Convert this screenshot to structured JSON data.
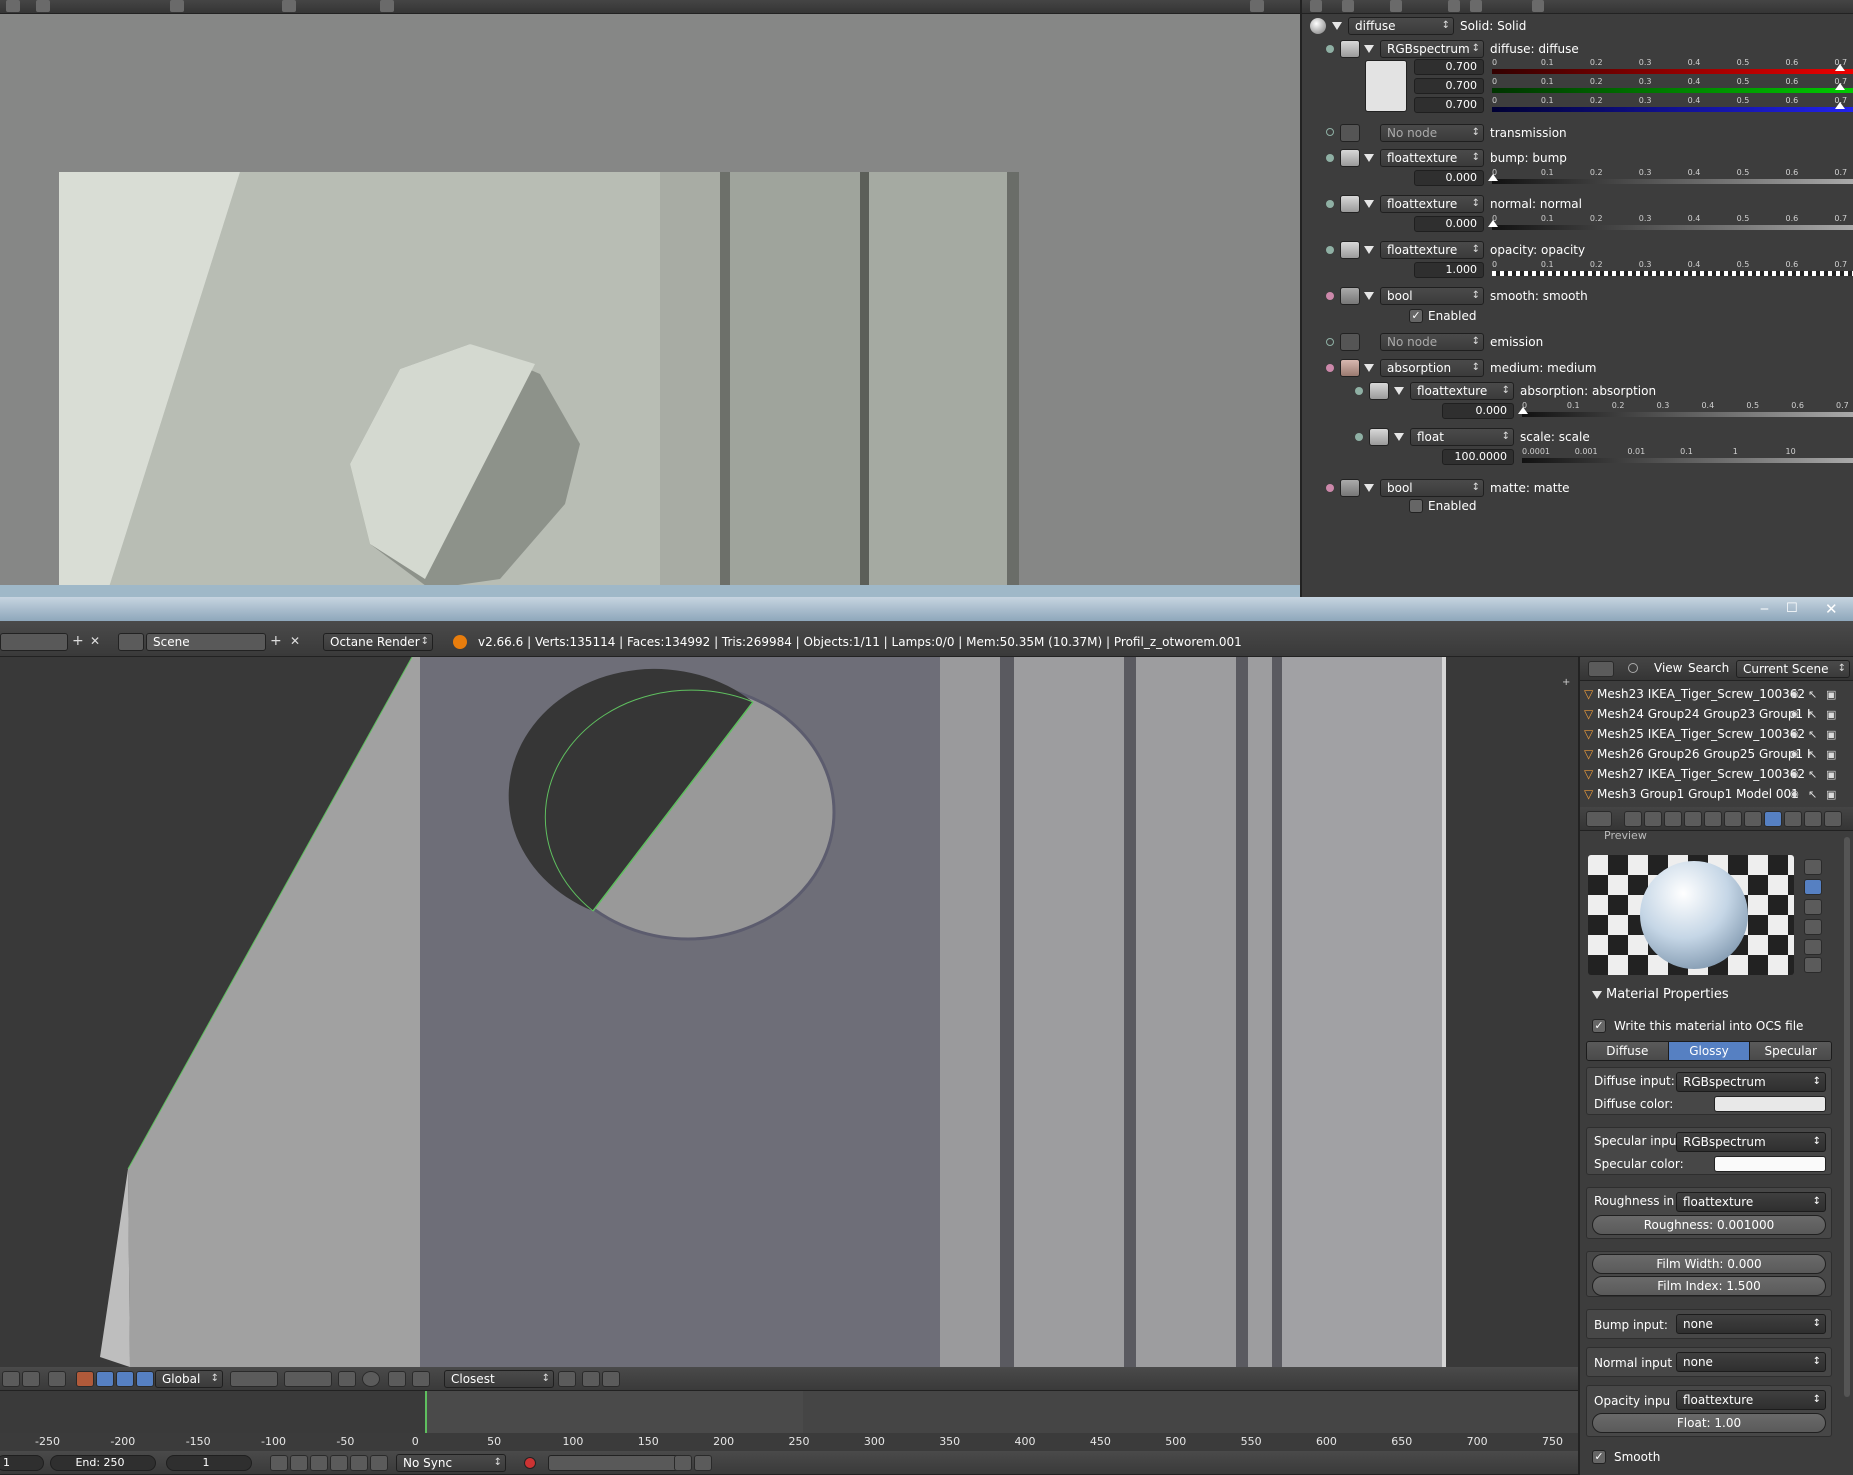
{
  "top_node_panel": {
    "material": {
      "name": "diffuse",
      "mode_label": "Solid: Solid"
    },
    "inputs": [
      {
        "type": "RGBspectrum",
        "label": "diffuse: diffuse",
        "values": [
          "0.700",
          "0.700",
          "0.700"
        ]
      },
      {
        "type": "No node",
        "label": "transmission"
      },
      {
        "type": "floattexture",
        "label": "bump: bump",
        "value": "0.000"
      },
      {
        "type": "floattexture",
        "label": "normal: normal",
        "value": "0.000"
      },
      {
        "type": "floattexture",
        "label": "opacity: opacity",
        "value": "1.000"
      },
      {
        "type": "bool",
        "label": "smooth: smooth",
        "checkbox_label": "Enabled",
        "checked": true
      },
      {
        "type": "No node",
        "label": "emission"
      },
      {
        "type": "absorption",
        "label": "medium: medium"
      },
      {
        "type": "floattexture",
        "label": "absorption: absorption",
        "value": "0.000"
      },
      {
        "type": "float",
        "label": "scale: scale",
        "value": "100.0000"
      },
      {
        "type": "bool",
        "label": "matte: matte",
        "checkbox_label": "Enabled",
        "checked": false
      }
    ],
    "slider_ticks": [
      "0",
      "0.1",
      "0.2",
      "0.3",
      "0.4",
      "0.5",
      "0.6",
      "0.7"
    ],
    "log_ticks": [
      "0.0001",
      "0.001",
      "0.01",
      "0.1",
      "1",
      "10"
    ]
  },
  "info_header": {
    "scene_label": "Scene",
    "render_engine": "Octane Render",
    "stats": "v2.66.6 | Verts:135114 | Faces:134992 | Tris:269984 | Objects:1/11 | Lamps:0/0 | Mem:50.35M (10.37M) | Profil_z_otworem.001"
  },
  "outliner": {
    "menu_view": "View",
    "menu_search": "Search",
    "scene_filter": "Current Scene",
    "rows": [
      "Mesh23 IKEA_Tiger_Screw_100362",
      "Mesh24 Group24 Group23 Group1 I",
      "Mesh25 IKEA_Tiger_Screw_100362",
      "Mesh26 Group26 Group25 Group1 I",
      "Mesh27 IKEA_Tiger_Screw_100362",
      "Mesh3 Group1 Group1 Model 001"
    ]
  },
  "properties": {
    "preview_label": "Preview",
    "section_title": "Material Properties",
    "write_ocs_label": "Write this material into OCS file",
    "type_tabs": [
      "Diffuse",
      "Glossy",
      "Specular"
    ],
    "active_tab": "Glossy",
    "diffuse_input_label": "Diffuse input:",
    "diffuse_input_value": "RGBspectrum",
    "diffuse_color_label": "Diffuse color:",
    "specular_input_label": "Specular inpu",
    "specular_input_value": "RGBspectrum",
    "specular_color_label": "Specular color:",
    "roughness_input_label": "Roughness in",
    "roughness_input_value": "floattexture",
    "roughness_value": "Roughness: 0.001000",
    "film_width": "Film Width: 0.000",
    "film_index": "Film Index: 1.500",
    "bump_input_label": "Bump input:",
    "bump_input_value": "none",
    "normal_input_label": "Normal input",
    "normal_input_value": "none",
    "opacity_input_label": "Opacity inpu",
    "opacity_input_value": "floattexture",
    "opacity_float": "Float: 1.00",
    "smooth_label": "Smooth"
  },
  "viewport_header": {
    "orientation": "Global",
    "snap_mode": "Closest"
  },
  "timeline": {
    "ticks": [
      "-250",
      "-200",
      "-150",
      "-100",
      "-50",
      "0",
      "50",
      "100",
      "150",
      "200",
      "250",
      "300",
      "350",
      "400",
      "450",
      "500",
      "550",
      "600",
      "650",
      "700",
      "750"
    ],
    "start_value": "1",
    "end_value": "End: 250",
    "current_frame": "1",
    "sync_mode": "No Sync"
  },
  "colors": {
    "panel_bg": "#3d3d3d",
    "active_tab": "#5680c2",
    "viewport_bg": "#393939",
    "selected_edge": "#5fbf5f"
  }
}
